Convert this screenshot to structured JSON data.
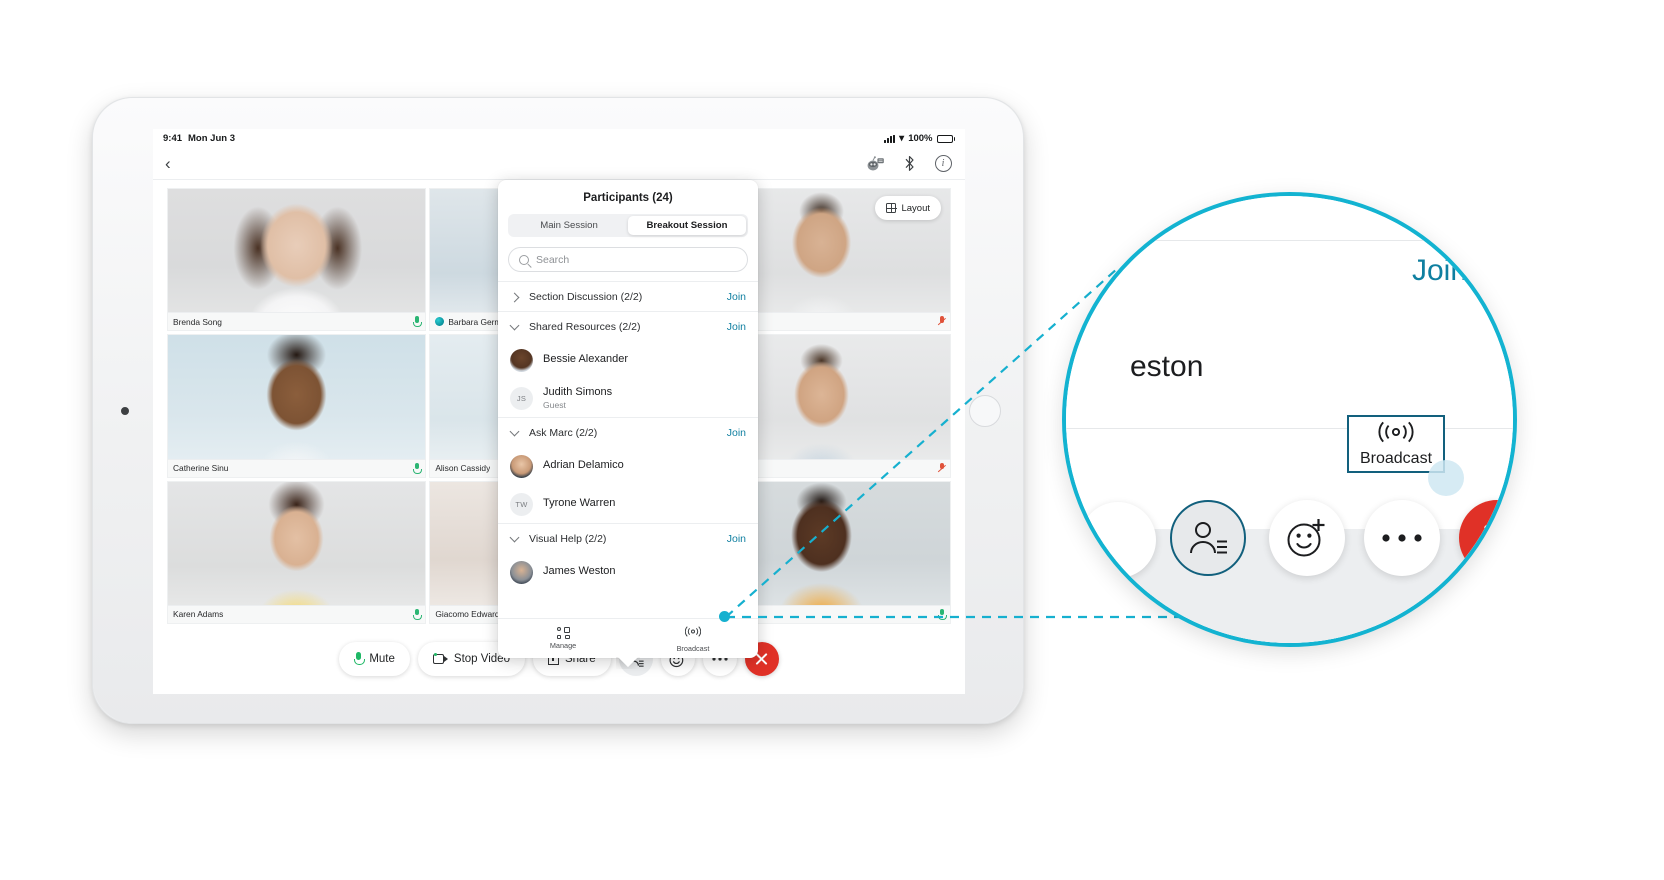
{
  "status_bar": {
    "time": "9:41",
    "date": "Mon Jun 3",
    "battery": "100%"
  },
  "nav": {
    "back_icon": "back-chevron-icon",
    "assistant_icon": "assistant-robot-icon",
    "bluetooth_icon": "bluetooth-icon",
    "info_icon": "info-icon"
  },
  "layout_button": {
    "label": "Layout"
  },
  "video_tiles": [
    {
      "name": "Brenda Song",
      "mic": "on",
      "badge": ""
    },
    {
      "name": "Barbara Germ",
      "mic": "",
      "badge": "webex"
    },
    {
      "name": "",
      "mic": "muted",
      "badge": ""
    },
    {
      "name": "Catherine Sinu",
      "mic": "on",
      "badge": ""
    },
    {
      "name": "Alison Cassidy",
      "mic": "",
      "badge": ""
    },
    {
      "name": "",
      "mic": "muted",
      "badge": ""
    },
    {
      "name": "Karen Adams",
      "mic": "on",
      "badge": ""
    },
    {
      "name": "Giacomo Edward",
      "mic": "",
      "badge": ""
    },
    {
      "name": "",
      "mic": "on",
      "badge": ""
    }
  ],
  "panel": {
    "title": "Participants (24)",
    "tabs": [
      {
        "label": "Main Session",
        "selected": false
      },
      {
        "label": "Breakout Session",
        "selected": true
      }
    ],
    "search_placeholder": "Search",
    "groups": [
      {
        "name": "Section Discussion (2/2)",
        "join_label": "Join",
        "expanded": false,
        "members": []
      },
      {
        "name": "Shared Resources (2/2)",
        "join_label": "Join",
        "expanded": true,
        "members": [
          {
            "name": "Bessie Alexander",
            "sub": "",
            "initials": ""
          },
          {
            "name": "Judith Simons",
            "sub": "Guest",
            "initials": "JS"
          }
        ]
      },
      {
        "name": "Ask Marc (2/2)",
        "join_label": "Join",
        "expanded": true,
        "members": [
          {
            "name": "Adrian Delamico",
            "sub": "",
            "initials": ""
          },
          {
            "name": "Tyrone Warren",
            "sub": "",
            "initials": "TW"
          }
        ]
      },
      {
        "name": "Visual Help (2/2)",
        "join_label": "Join",
        "expanded": true,
        "members": [
          {
            "name": "James Weston",
            "sub": "",
            "initials": ""
          }
        ]
      }
    ],
    "footer": [
      {
        "label": "Manage",
        "icon": "manage-grid-icon"
      },
      {
        "label": "Broadcast",
        "icon": "broadcast-icon"
      }
    ]
  },
  "toolbar": {
    "mute_label": "Mute",
    "stop_video_label": "Stop Video",
    "share_label": "Share",
    "participants_icon": "participants-icon",
    "reactions_icon": "reactions-smiley-icon",
    "more_icon": "more-options-icon",
    "end_call_icon": "end-call-icon"
  },
  "magnifier": {
    "join_label": "Join",
    "partial_name": "eston",
    "broadcast_label": "Broadcast",
    "broadcast_icon": "broadcast-icon",
    "participants_icon": "participants-icon",
    "reactions_icon": "reactions-smiley-icon",
    "more_icon": "more-options-icon",
    "end_call_icon": "end-call-icon"
  },
  "colors": {
    "accent_cyan": "#13b3d1",
    "link_blue": "#0f7fa0",
    "highlight_blue": "#12607d",
    "end_red": "#e03127",
    "mic_green": "#1fb866"
  }
}
